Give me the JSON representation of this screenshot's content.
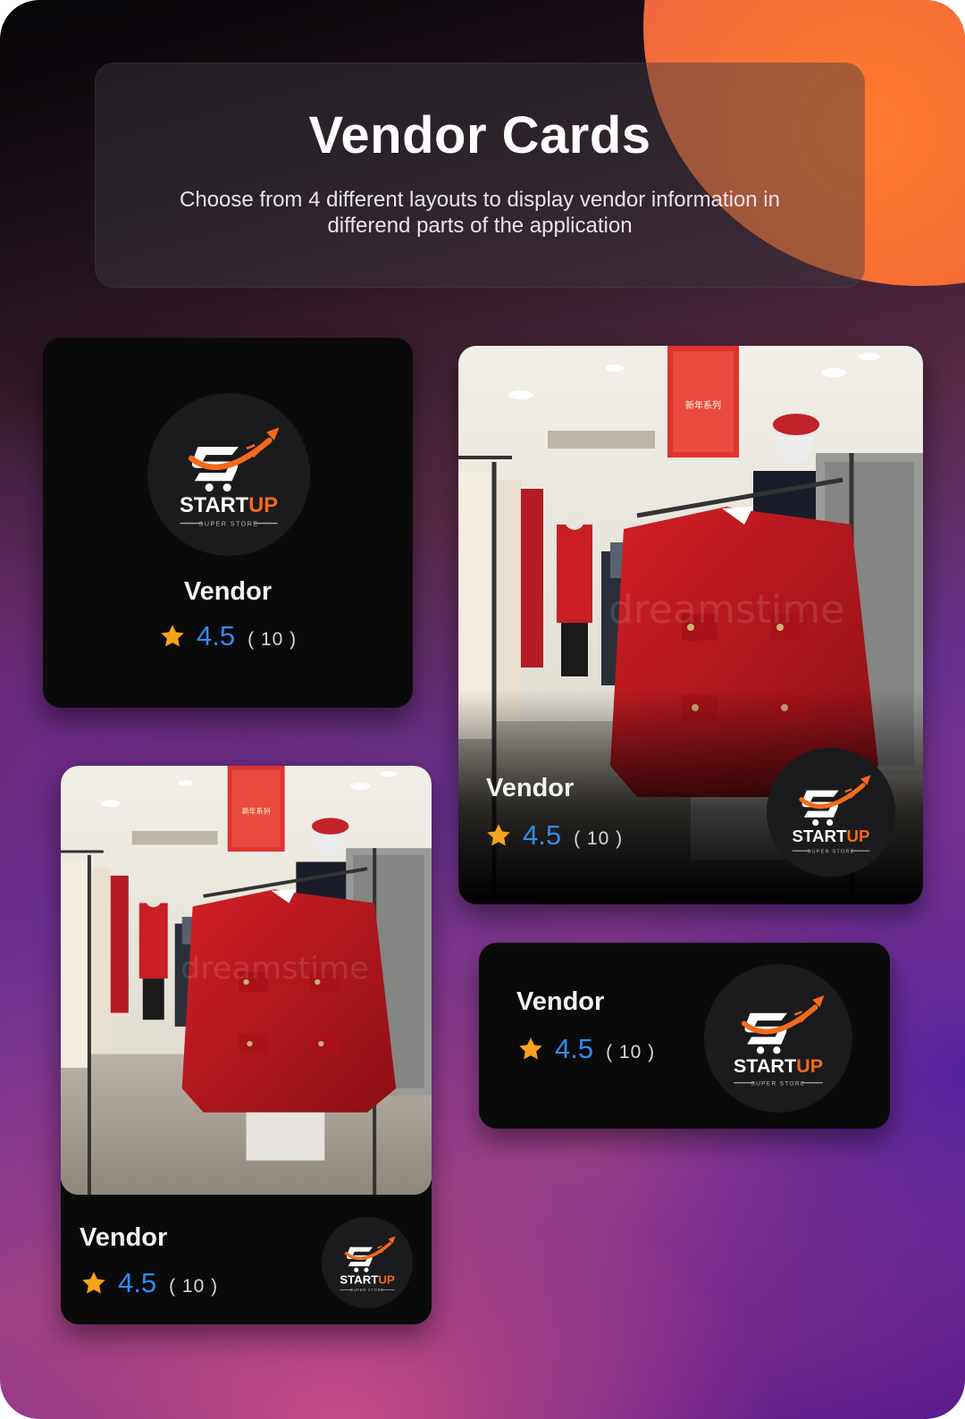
{
  "header": {
    "title": "Vendor Cards",
    "subtitle": "Choose from 4 different layouts to display vendor information in differend parts of the application"
  },
  "logo": {
    "brand_start": "START",
    "brand_up": "UP",
    "tagline": "SUPER STORE"
  },
  "cards": [
    {
      "layout": "square-centered",
      "vendor_name": "Vendor",
      "rating": "4.5",
      "reviews": "( 10 )"
    },
    {
      "layout": "image-overlay",
      "vendor_name": "Vendor",
      "rating": "4.5",
      "reviews": "( 10 )"
    },
    {
      "layout": "image-footer",
      "vendor_name": "Vendor",
      "rating": "4.5",
      "reviews": "( 10 )"
    },
    {
      "layout": "compact-horizontal",
      "vendor_name": "Vendor",
      "rating": "4.5",
      "reviews": "( 10 )"
    }
  ],
  "icons": [
    "star-icon",
    "startup-logo",
    "store-photo"
  ],
  "colors": {
    "accent_blue": "#2f8cf0",
    "star": "#f7a21b",
    "brand_orange": "#f26a1b",
    "card_bg": "#0a0a0b"
  }
}
